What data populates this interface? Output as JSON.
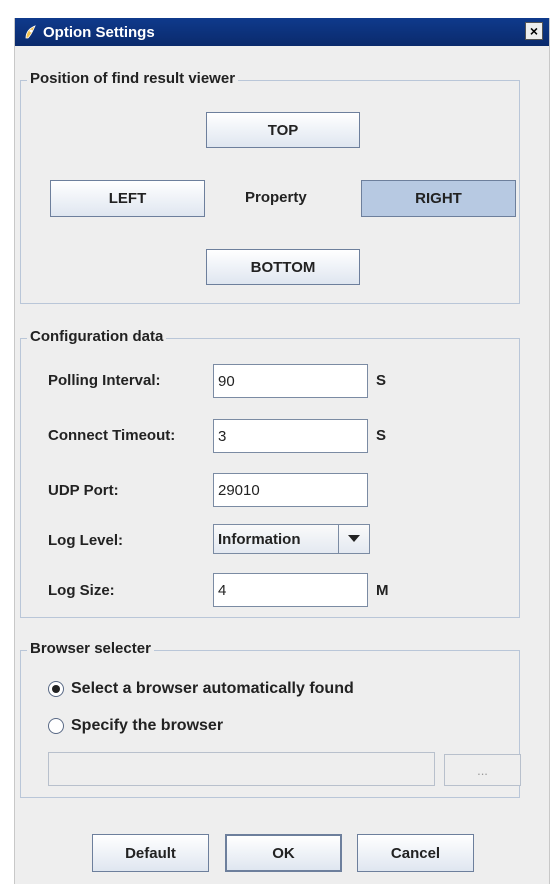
{
  "window": {
    "title": "Option Settings",
    "close_label": "×"
  },
  "position_group": {
    "legend": "Position of find result  viewer",
    "top_label": "TOP",
    "left_label": "LEFT",
    "center_label": "Property",
    "right_label": "RIGHT",
    "bottom_label": "BOTTOM",
    "selected": "RIGHT"
  },
  "config_group": {
    "legend": "Configuration data",
    "polling_label": "Polling Interval:",
    "polling_value": "90",
    "polling_unit": "S",
    "timeout_label": "Connect Timeout:",
    "timeout_value": "3",
    "timeout_unit": "S",
    "udp_label": "UDP Port:",
    "udp_value": "29010",
    "loglevel_label": "Log Level:",
    "loglevel_value": "Information",
    "logsize_label": "Log Size:",
    "logsize_value": "4",
    "logsize_unit": "M"
  },
  "browser_group": {
    "legend": "Browser selecter",
    "option_auto": "Select a browser automatically found",
    "option_specify": "Specify the browser",
    "selected": "auto",
    "path_value": "",
    "browse_label": "..."
  },
  "footer": {
    "default_label": "Default",
    "ok_label": "OK",
    "cancel_label": "Cancel"
  },
  "colors": {
    "titlebar": "#0a2a6c",
    "selected_button": "#b7c9e2"
  }
}
